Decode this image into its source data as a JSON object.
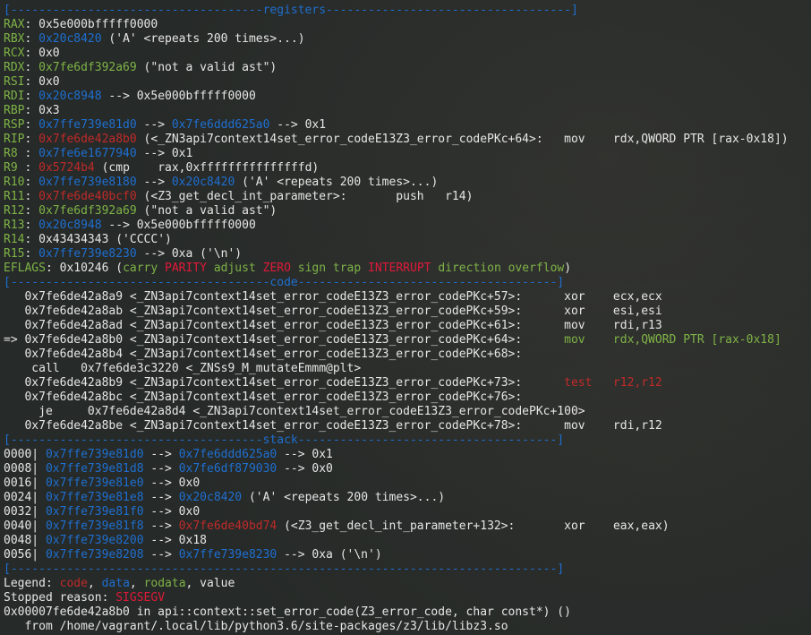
{
  "colors": {
    "register_name": "#7fb347",
    "stack_address": "#1f6fd0",
    "code_address": "#c02a2a",
    "separator": "#1f6fd0",
    "flag_set": "#e0193a",
    "flag_clear": "#7fb347",
    "text": "#e6e6e6"
  },
  "headers": {
    "registers": "[------------------------------------registers-----------------------------------]",
    "code": "[-------------------------------------code-------------------------------------]",
    "stack": "[------------------------------------stack-------------------------------------]",
    "footer": "[------------------------------------------------------------------------------]"
  },
  "registers": [
    {
      "name": "RAX",
      "segs": [
        {
          "t": "0x5e000bfffff0000",
          "c": ""
        }
      ]
    },
    {
      "name": "RBX",
      "segs": [
        {
          "t": "0x20c8420",
          "c": "stk"
        },
        {
          "t": " ('A' <repeats 200 times>...)",
          "c": ""
        }
      ]
    },
    {
      "name": "RCX",
      "segs": [
        {
          "t": "0x0",
          "c": ""
        }
      ]
    },
    {
      "name": "RDX",
      "segs": [
        {
          "t": "0x7fe6df392a69",
          "c": "rod"
        },
        {
          "t": " (\"not a valid ast\")",
          "c": ""
        }
      ]
    },
    {
      "name": "RSI",
      "segs": [
        {
          "t": "0x0",
          "c": ""
        }
      ]
    },
    {
      "name": "RDI",
      "segs": [
        {
          "t": "0x20c8948",
          "c": "stk"
        },
        {
          "t": " --> 0x5e000bfffff0000",
          "c": ""
        }
      ]
    },
    {
      "name": "RBP",
      "segs": [
        {
          "t": "0x3",
          "c": ""
        }
      ]
    },
    {
      "name": "RSP",
      "segs": [
        {
          "t": "0x7ffe739e81d0",
          "c": "stk"
        },
        {
          "t": " --> ",
          "c": ""
        },
        {
          "t": "0x7fe6ddd625a0",
          "c": "stk"
        },
        {
          "t": " --> 0x1",
          "c": ""
        }
      ]
    },
    {
      "name": "RIP",
      "segs": [
        {
          "t": "0x7fe6de42a8b0",
          "c": "cod"
        },
        {
          "t": " (<_ZN3api7context14set_error_codeE13Z3_error_codePKc+64>:   mov    rdx,QWORD PTR [rax-0x18])",
          "c": ""
        }
      ]
    },
    {
      "name": "R8 ",
      "segs": [
        {
          "t": "0x7fe6e1677940",
          "c": "stk"
        },
        {
          "t": " --> 0x1",
          "c": ""
        }
      ]
    },
    {
      "name": "R9 ",
      "segs": [
        {
          "t": "0x5724b4",
          "c": "cod"
        },
        {
          "t": " (cmp    rax,0xfffffffffffffffd)",
          "c": ""
        }
      ]
    },
    {
      "name": "R10",
      "segs": [
        {
          "t": "0x7ffe739e8180",
          "c": "stk"
        },
        {
          "t": " --> ",
          "c": ""
        },
        {
          "t": "0x20c8420",
          "c": "stk"
        },
        {
          "t": " ('A' <repeats 200 times>...)",
          "c": ""
        }
      ]
    },
    {
      "name": "R11",
      "segs": [
        {
          "t": "0x7fe6de40bcf0",
          "c": "cod"
        },
        {
          "t": " (<Z3_get_decl_int_parameter>:       push   r14)",
          "c": ""
        }
      ]
    },
    {
      "name": "R12",
      "segs": [
        {
          "t": "0x7fe6df392a69",
          "c": "rod"
        },
        {
          "t": " (\"not a valid ast\")",
          "c": ""
        }
      ]
    },
    {
      "name": "R13",
      "segs": [
        {
          "t": "0x20c8948",
          "c": "stk"
        },
        {
          "t": " --> 0x5e000bfffff0000",
          "c": ""
        }
      ]
    },
    {
      "name": "R14",
      "segs": [
        {
          "t": "0x43434343 ('CCCC')",
          "c": ""
        }
      ]
    },
    {
      "name": "R15",
      "segs": [
        {
          "t": "0x7ffe739e8230",
          "c": "stk"
        },
        {
          "t": " --> 0xa ('\\n')",
          "c": ""
        }
      ]
    }
  ],
  "eflags": {
    "name": "EFLAGS",
    "value": "0x10246",
    "flags": [
      {
        "t": "carry",
        "set": false
      },
      {
        "t": "PARITY",
        "set": true
      },
      {
        "t": "adjust",
        "set": false
      },
      {
        "t": "ZERO",
        "set": true
      },
      {
        "t": "sign",
        "set": false
      },
      {
        "t": "trap",
        "set": false
      },
      {
        "t": "INTERRUPT",
        "set": true
      },
      {
        "t": "direction",
        "set": false
      },
      {
        "t": "overflow",
        "set": false
      }
    ]
  },
  "code": [
    {
      "segs": [
        {
          "t": "   0x7fe6de42a8a9 <_ZN3api7context14set_error_codeE13Z3_error_codePKc+57>:      xor    ecx,ecx",
          "c": ""
        }
      ]
    },
    {
      "segs": [
        {
          "t": "   0x7fe6de42a8ab <_ZN3api7context14set_error_codeE13Z3_error_codePKc+59>:      xor    esi,esi",
          "c": ""
        }
      ]
    },
    {
      "segs": [
        {
          "t": "   0x7fe6de42a8ad <_ZN3api7context14set_error_codeE13Z3_error_codePKc+61>:      mov    rdi,r13",
          "c": ""
        }
      ]
    },
    {
      "segs": [
        {
          "t": "=> 0x7fe6de42a8b0 <_ZN3api7context14set_error_codeE13Z3_error_codePKc+64>:      ",
          "c": ""
        },
        {
          "t": "mov    rdx,QWORD PTR [rax-0x18]",
          "c": "cur"
        }
      ]
    },
    {
      "segs": [
        {
          "t": "   0x7fe6de42a8b4 <_ZN3api7context14set_error_codeE13Z3_error_codePKc+68>:",
          "c": ""
        }
      ]
    },
    {
      "segs": [
        {
          "t": "    call   0x7fe6de3c3220 <_ZNSs9_M_mutateEmmm@plt>",
          "c": ""
        }
      ]
    },
    {
      "segs": [
        {
          "t": "   0x7fe6de42a8b9 <_ZN3api7context14set_error_codeE13Z3_error_codePKc+73>:      ",
          "c": ""
        },
        {
          "t": "test   r12,r12",
          "c": "brk"
        }
      ]
    },
    {
      "segs": [
        {
          "t": "   0x7fe6de42a8bc <_ZN3api7context14set_error_codeE13Z3_error_codePKc+76>:",
          "c": ""
        }
      ]
    },
    {
      "segs": [
        {
          "t": "     je     0x7fe6de42a8d4 <_ZN3api7context14set_error_codeE13Z3_error_codePKc+100>",
          "c": ""
        }
      ]
    },
    {
      "segs": [
        {
          "t": "   0x7fe6de42a8be <_ZN3api7context14set_error_codeE13Z3_error_codePKc+78>:      mov    rdi,r12",
          "c": ""
        }
      ]
    }
  ],
  "stack": [
    {
      "segs": [
        {
          "t": "0000| ",
          "c": ""
        },
        {
          "t": "0x7ffe739e81d0",
          "c": "stk"
        },
        {
          "t": " --> ",
          "c": ""
        },
        {
          "t": "0x7fe6ddd625a0",
          "c": "stk"
        },
        {
          "t": " --> 0x1",
          "c": ""
        }
      ]
    },
    {
      "segs": [
        {
          "t": "0008| ",
          "c": ""
        },
        {
          "t": "0x7ffe739e81d8",
          "c": "stk"
        },
        {
          "t": " --> ",
          "c": ""
        },
        {
          "t": "0x7fe6df879030",
          "c": "stk"
        },
        {
          "t": " --> 0x0",
          "c": ""
        }
      ]
    },
    {
      "segs": [
        {
          "t": "0016| ",
          "c": ""
        },
        {
          "t": "0x7ffe739e81e0",
          "c": "stk"
        },
        {
          "t": " --> 0x0",
          "c": ""
        }
      ]
    },
    {
      "segs": [
        {
          "t": "0024| ",
          "c": ""
        },
        {
          "t": "0x7ffe739e81e8",
          "c": "stk"
        },
        {
          "t": " --> ",
          "c": ""
        },
        {
          "t": "0x20c8420",
          "c": "stk"
        },
        {
          "t": " ('A' <repeats 200 times>...)",
          "c": ""
        }
      ]
    },
    {
      "segs": [
        {
          "t": "0032| ",
          "c": ""
        },
        {
          "t": "0x7ffe739e81f0",
          "c": "stk"
        },
        {
          "t": " --> 0x0",
          "c": ""
        }
      ]
    },
    {
      "segs": [
        {
          "t": "0040| ",
          "c": ""
        },
        {
          "t": "0x7ffe739e81f8",
          "c": "stk"
        },
        {
          "t": " --> ",
          "c": ""
        },
        {
          "t": "0x7fe6de40bd74",
          "c": "cod"
        },
        {
          "t": " (<Z3_get_decl_int_parameter+132>:       xor    eax,eax)",
          "c": ""
        }
      ]
    },
    {
      "segs": [
        {
          "t": "0048| ",
          "c": ""
        },
        {
          "t": "0x7ffe739e8200",
          "c": "stk"
        },
        {
          "t": " --> 0x18",
          "c": ""
        }
      ]
    },
    {
      "segs": [
        {
          "t": "0056| ",
          "c": ""
        },
        {
          "t": "0x7ffe739e8208",
          "c": "stk"
        },
        {
          "t": " --> ",
          "c": ""
        },
        {
          "t": "0x7ffe739e8230",
          "c": "stk"
        },
        {
          "t": " --> 0xa ('\\n')",
          "c": ""
        }
      ]
    }
  ],
  "legend": {
    "prefix": "Legend: ",
    "items": [
      {
        "t": "code",
        "c": "cod"
      },
      {
        "t": ", ",
        "c": ""
      },
      {
        "t": "data",
        "c": "dat"
      },
      {
        "t": ", ",
        "c": ""
      },
      {
        "t": "rodata",
        "c": "rod"
      },
      {
        "t": ", value",
        "c": ""
      }
    ]
  },
  "stop": {
    "prefix": "Stopped reason: ",
    "reason": "SIGSEGV"
  },
  "frame_line": "0x00007fe6de42a8b0 in api::context::set_error_code(Z3_error_code, char const*) ()",
  "from_line": "   from /home/vagrant/.local/lib/python3.6/site-packages/z3/lib/libz3.so"
}
